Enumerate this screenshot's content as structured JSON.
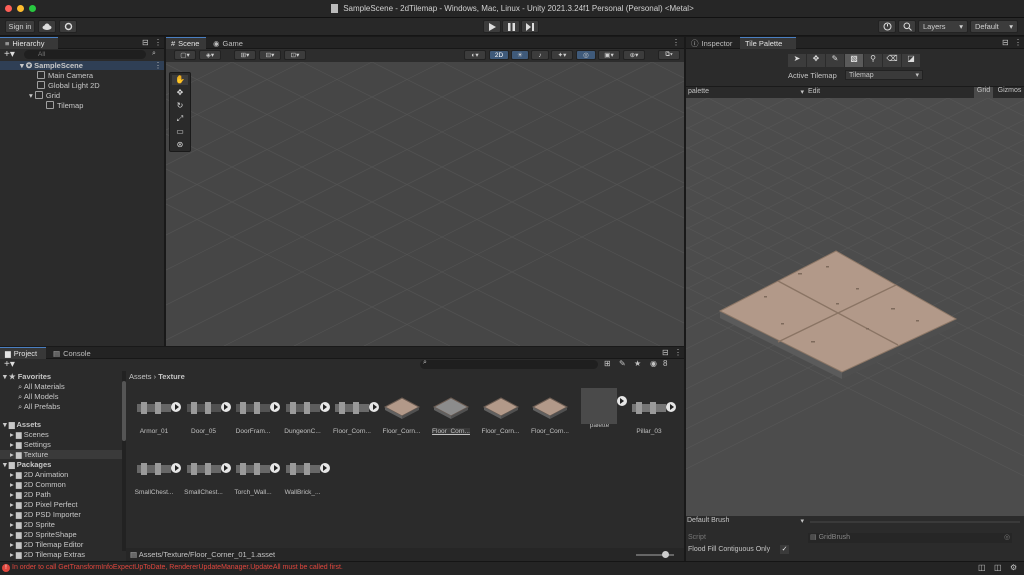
{
  "window": {
    "title": "SampleScene - 2dTilemap - Windows, Mac, Linux - Unity 2021.3.24f1 Personal (Personal) <Metal>"
  },
  "toolbar": {
    "sign_in": "Sign in",
    "layers": "Layers",
    "layout": "Default"
  },
  "hierarchy": {
    "tab": "Hierarchy",
    "search_placeholder": "All",
    "items": [
      {
        "label": "SampleScene",
        "depth": 0
      },
      {
        "label": "Main Camera",
        "depth": 1
      },
      {
        "label": "Global Light 2D",
        "depth": 1
      },
      {
        "label": "Grid",
        "depth": 1
      },
      {
        "label": "Tilemap",
        "depth": 2
      }
    ]
  },
  "scene": {
    "tab_scene": "Scene",
    "tab_game": "Game",
    "mode_2d": "2D"
  },
  "inspector": {
    "tab_inspector": "Inspector",
    "tab_tile_palette": "Tile Palette",
    "active_tilemap_label": "Active Tilemap",
    "active_tilemap_value": "Tilemap",
    "palette_select": "palette",
    "edit": "Edit",
    "grid": "Grid",
    "gizmos": "Gizmos",
    "brush_select": "Default Brush",
    "script_label": "Script",
    "script_value": "GridBrush",
    "flood_fill_label": "Flood Fill Contiguous Only",
    "flood_fill_checked": "✓"
  },
  "project": {
    "tab_project": "Project",
    "tab_console": "Console",
    "breadcrumb_root": "Assets",
    "breadcrumb_sep": "›",
    "breadcrumb_leaf": "Texture",
    "hidden_count": "8",
    "favorites": {
      "header": "Favorites",
      "items": [
        "All Materials",
        "All Models",
        "All Prefabs"
      ]
    },
    "assets": {
      "header": "Assets",
      "items": [
        "Scenes",
        "Settings",
        "Texture"
      ]
    },
    "packages": {
      "header": "Packages",
      "items": [
        "2D Animation",
        "2D Common",
        "2D Path",
        "2D Pixel Perfect",
        "2D PSD Importer",
        "2D Sprite",
        "2D SpriteShape",
        "2D Tilemap Editor",
        "2D Tilemap Extras",
        "Burst"
      ]
    },
    "grid_row1": [
      "Armor_01",
      "Door_05",
      "DoorFram...",
      "DungeonC...",
      "Floor_Corn...",
      "Floor_Corn...",
      "Floor_Corn...",
      "Floor_Corn...",
      "Floor_Corn...",
      "palette",
      "Pillar_03"
    ],
    "grid_row2": [
      "SmallChest...",
      "SmallChest...",
      "Torch_Wall...",
      "WallBrick_..."
    ],
    "selected_path": "Assets/Texture/Floor_Corner_01_1.asset"
  },
  "status": {
    "error": "In order to call GetTransformInfoExpectUpToDate, RendererUpdateManager.UpdateAll must be called first."
  },
  "colors": {
    "accent": "#4a7fc1",
    "error": "#e0463d",
    "tile": "#b39a8a"
  }
}
